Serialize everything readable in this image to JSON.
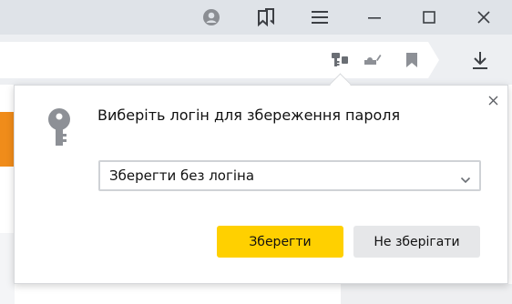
{
  "titlebar": {
    "icons": {
      "profile": "profile-icon",
      "bookmarks": "bookmarks-collection-icon",
      "menu": "hamburger-menu-icon",
      "minimize": "minimize-icon",
      "maximize": "maximize-icon",
      "close": "close-window-icon"
    }
  },
  "addressbar": {
    "icons": {
      "password_manager": "password-key-icon",
      "turbo": "turbo-mode-icon",
      "bookmark": "bookmark-icon",
      "downloads": "download-icon"
    }
  },
  "colors": {
    "accent_yellow": "#ffd000",
    "titlebar_bg": "#dfe3e8",
    "background_orange": "#f08c1a"
  },
  "popup": {
    "title": "Виберіть логін для збереження пароля",
    "login_select": {
      "selected_value": "Зберегти без логіна"
    },
    "save_button": "Зберегти",
    "dont_save_button": "Не зберігати"
  }
}
